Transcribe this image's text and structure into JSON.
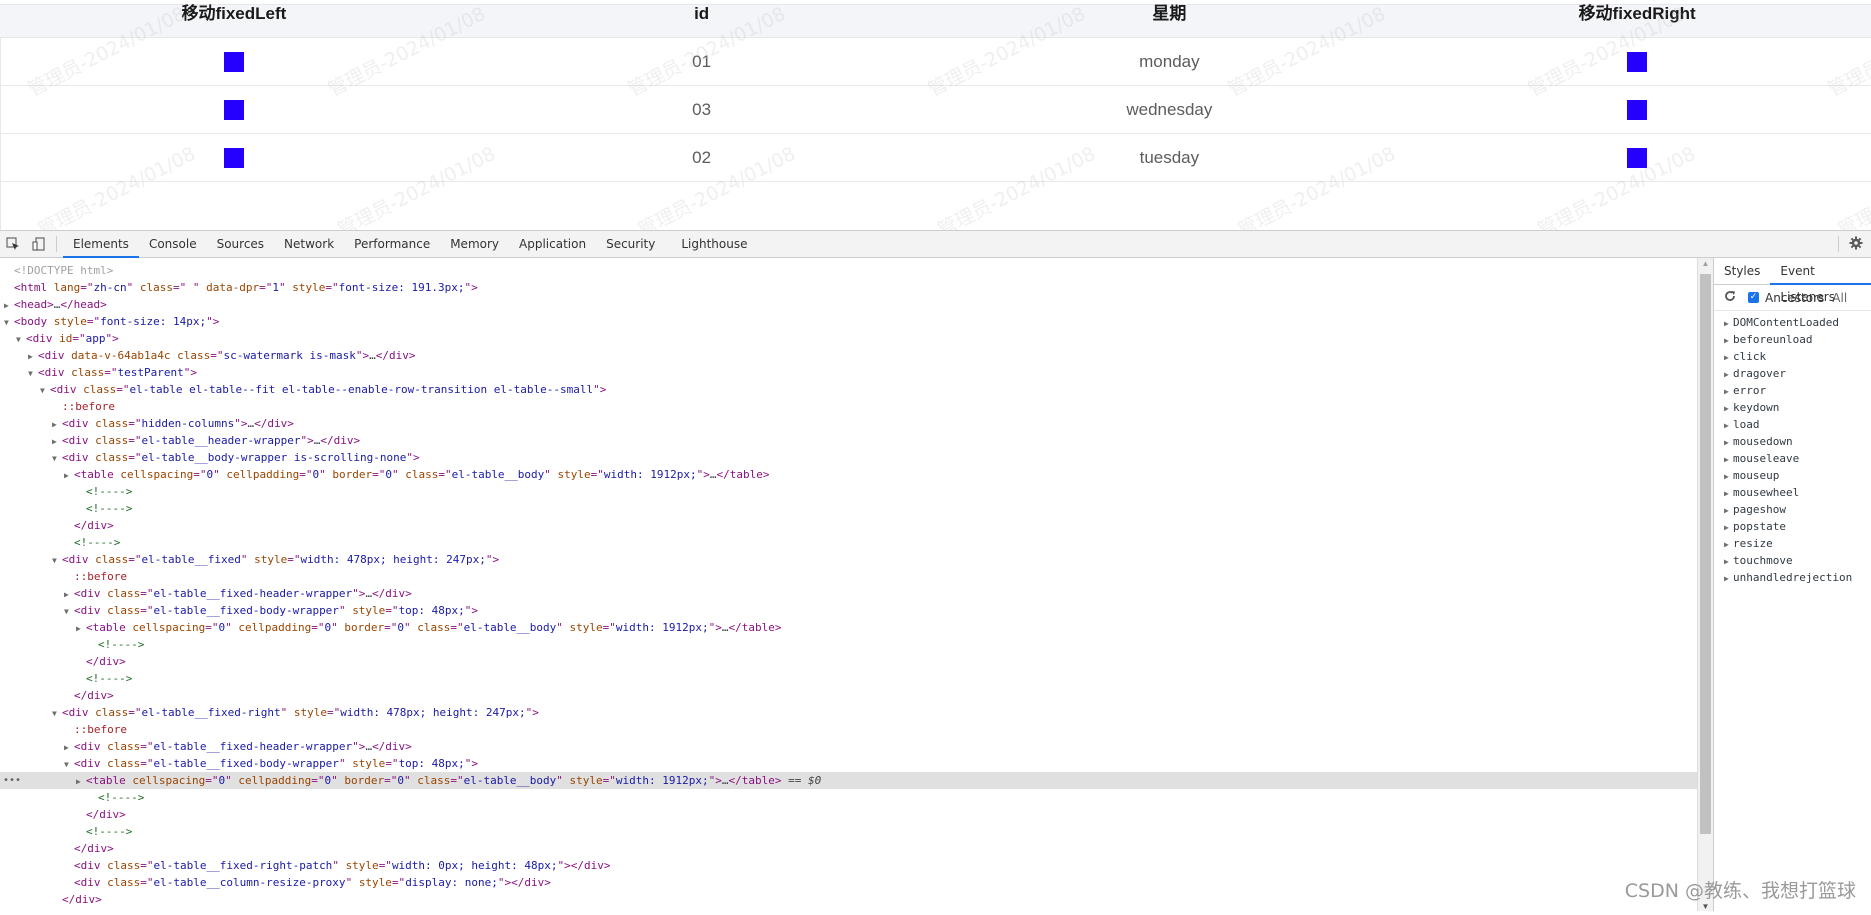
{
  "table": {
    "columns": [
      "移动fixedLeft",
      "id",
      "星期",
      "移动fixedRight"
    ],
    "rows": [
      {
        "id": "01",
        "day": "monday"
      },
      {
        "id": "03",
        "day": "wednesday"
      },
      {
        "id": "02",
        "day": "tuesday"
      }
    ],
    "cell_square_color": "#2600ff",
    "watermark": "管理员-2024/01/08"
  },
  "devtools": {
    "tabs": [
      "Elements",
      "Console",
      "Sources",
      "Network",
      "Performance",
      "Memory",
      "Application",
      "Security",
      "Lighthouse"
    ],
    "active_tab": "Elements",
    "icons": [
      "inspect-element-icon",
      "device-toolbar-icon",
      "settings-gear-icon"
    ],
    "dom_lines": [
      {
        "indent": 0,
        "tri": "",
        "parts": [
          [
            "dt",
            "<!DOCTYPE html>"
          ]
        ]
      },
      {
        "indent": 0,
        "tri": "",
        "parts": [
          [
            "tag",
            "<html "
          ],
          [
            "an",
            "lang"
          ],
          [
            "tag",
            "=\""
          ],
          [
            "av",
            "zh-cn"
          ],
          [
            "tag",
            "\" "
          ],
          [
            "an",
            "class"
          ],
          [
            "tag",
            "=\""
          ],
          [
            "av",
            " "
          ],
          [
            "tag",
            "\" "
          ],
          [
            "an",
            "data-dpr"
          ],
          [
            "tag",
            "=\""
          ],
          [
            "av",
            "1"
          ],
          [
            "tag",
            "\" "
          ],
          [
            "an",
            "style"
          ],
          [
            "tag",
            "=\""
          ],
          [
            "av",
            "font-size: 191.3px;"
          ],
          [
            "tag",
            "\">"
          ]
        ]
      },
      {
        "indent": 0,
        "tri": "▶",
        "parts": [
          [
            "tag",
            "<head>"
          ],
          [
            "",
            "…"
          ],
          [
            "tag",
            "</head>"
          ]
        ]
      },
      {
        "indent": 0,
        "tri": "▼",
        "parts": [
          [
            "tag",
            "<body "
          ],
          [
            "an",
            "style"
          ],
          [
            "tag",
            "=\""
          ],
          [
            "av",
            "font-size: 14px;"
          ],
          [
            "tag",
            "\">"
          ]
        ]
      },
      {
        "indent": 1,
        "tri": "▼",
        "parts": [
          [
            "tag",
            "<div "
          ],
          [
            "an",
            "id"
          ],
          [
            "tag",
            "=\""
          ],
          [
            "av",
            "app"
          ],
          [
            "tag",
            "\">"
          ]
        ]
      },
      {
        "indent": 2,
        "tri": "▶",
        "parts": [
          [
            "tag",
            "<div "
          ],
          [
            "an",
            "data-v-64ab1a4c class"
          ],
          [
            "tag",
            "=\""
          ],
          [
            "av",
            "sc-watermark is-mask"
          ],
          [
            "tag",
            "\">"
          ],
          [
            "",
            "…"
          ],
          [
            "tag",
            "</div>"
          ]
        ]
      },
      {
        "indent": 2,
        "tri": "▼",
        "parts": [
          [
            "tag",
            "<div "
          ],
          [
            "an",
            "class"
          ],
          [
            "tag",
            "=\""
          ],
          [
            "av",
            "testParent"
          ],
          [
            "tag",
            "\">"
          ]
        ]
      },
      {
        "indent": 3,
        "tri": "▼",
        "parts": [
          [
            "tag",
            "<div "
          ],
          [
            "an",
            "class"
          ],
          [
            "tag",
            "=\""
          ],
          [
            "av",
            "el-table el-table--fit el-table--enable-row-transition el-table--small"
          ],
          [
            "tag",
            "\">"
          ]
        ]
      },
      {
        "indent": 4,
        "tri": "",
        "parts": [
          [
            "ps",
            "::before"
          ]
        ]
      },
      {
        "indent": 4,
        "tri": "▶",
        "parts": [
          [
            "tag",
            "<div "
          ],
          [
            "an",
            "class"
          ],
          [
            "tag",
            "=\""
          ],
          [
            "av",
            "hidden-columns"
          ],
          [
            "tag",
            "\">"
          ],
          [
            "",
            "…"
          ],
          [
            "tag",
            "</div>"
          ]
        ]
      },
      {
        "indent": 4,
        "tri": "▶",
        "parts": [
          [
            "tag",
            "<div "
          ],
          [
            "an",
            "class"
          ],
          [
            "tag",
            "=\""
          ],
          [
            "av",
            "el-table__header-wrapper"
          ],
          [
            "tag",
            "\">"
          ],
          [
            "",
            "…"
          ],
          [
            "tag",
            "</div>"
          ]
        ]
      },
      {
        "indent": 4,
        "tri": "▼",
        "parts": [
          [
            "tag",
            "<div "
          ],
          [
            "an",
            "class"
          ],
          [
            "tag",
            "=\""
          ],
          [
            "av",
            "el-table__body-wrapper is-scrolling-none"
          ],
          [
            "tag",
            "\">"
          ]
        ]
      },
      {
        "indent": 5,
        "tri": "▶",
        "parts": [
          [
            "tag",
            "<table "
          ],
          [
            "an",
            "cellspacing"
          ],
          [
            "tag",
            "=\""
          ],
          [
            "av",
            "0"
          ],
          [
            "tag",
            "\" "
          ],
          [
            "an",
            "cellpadding"
          ],
          [
            "tag",
            "=\""
          ],
          [
            "av",
            "0"
          ],
          [
            "tag",
            "\" "
          ],
          [
            "an",
            "border"
          ],
          [
            "tag",
            "=\""
          ],
          [
            "av",
            "0"
          ],
          [
            "tag",
            "\" "
          ],
          [
            "an",
            "class"
          ],
          [
            "tag",
            "=\""
          ],
          [
            "av",
            "el-table__body"
          ],
          [
            "tag",
            "\" "
          ],
          [
            "an",
            "style"
          ],
          [
            "tag",
            "=\""
          ],
          [
            "av",
            "width: 1912px;"
          ],
          [
            "tag",
            "\">"
          ],
          [
            "",
            "…"
          ],
          [
            "tag",
            "</table>"
          ]
        ]
      },
      {
        "indent": 6,
        "tri": "",
        "parts": [
          [
            "cm",
            "<!---->"
          ]
        ]
      },
      {
        "indent": 6,
        "tri": "",
        "parts": [
          [
            "cm",
            "<!---->"
          ]
        ]
      },
      {
        "indent": 5,
        "tri": "",
        "parts": [
          [
            "tag",
            "</div>"
          ]
        ]
      },
      {
        "indent": 5,
        "tri": "",
        "parts": [
          [
            "cm",
            "<!---->"
          ]
        ]
      },
      {
        "indent": 4,
        "tri": "▼",
        "parts": [
          [
            "tag",
            "<div "
          ],
          [
            "an",
            "class"
          ],
          [
            "tag",
            "=\""
          ],
          [
            "av",
            "el-table__fixed"
          ],
          [
            "tag",
            "\" "
          ],
          [
            "an",
            "style"
          ],
          [
            "tag",
            "=\""
          ],
          [
            "av",
            "width: 478px; height: 247px;"
          ],
          [
            "tag",
            "\">"
          ]
        ]
      },
      {
        "indent": 5,
        "tri": "",
        "parts": [
          [
            "ps",
            "::before"
          ]
        ]
      },
      {
        "indent": 5,
        "tri": "▶",
        "parts": [
          [
            "tag",
            "<div "
          ],
          [
            "an",
            "class"
          ],
          [
            "tag",
            "=\""
          ],
          [
            "av",
            "el-table__fixed-header-wrapper"
          ],
          [
            "tag",
            "\">"
          ],
          [
            "",
            "…"
          ],
          [
            "tag",
            "</div>"
          ]
        ]
      },
      {
        "indent": 5,
        "tri": "▼",
        "parts": [
          [
            "tag",
            "<div "
          ],
          [
            "an",
            "class"
          ],
          [
            "tag",
            "=\""
          ],
          [
            "av",
            "el-table__fixed-body-wrapper"
          ],
          [
            "tag",
            "\" "
          ],
          [
            "an",
            "style"
          ],
          [
            "tag",
            "=\""
          ],
          [
            "av",
            "top: 48px;"
          ],
          [
            "tag",
            "\">"
          ]
        ]
      },
      {
        "indent": 6,
        "tri": "▶",
        "parts": [
          [
            "tag",
            "<table "
          ],
          [
            "an",
            "cellspacing"
          ],
          [
            "tag",
            "=\""
          ],
          [
            "av",
            "0"
          ],
          [
            "tag",
            "\" "
          ],
          [
            "an",
            "cellpadding"
          ],
          [
            "tag",
            "=\""
          ],
          [
            "av",
            "0"
          ],
          [
            "tag",
            "\" "
          ],
          [
            "an",
            "border"
          ],
          [
            "tag",
            "=\""
          ],
          [
            "av",
            "0"
          ],
          [
            "tag",
            "\" "
          ],
          [
            "an",
            "class"
          ],
          [
            "tag",
            "=\""
          ],
          [
            "av",
            "el-table__body"
          ],
          [
            "tag",
            "\" "
          ],
          [
            "an",
            "style"
          ],
          [
            "tag",
            "=\""
          ],
          [
            "av",
            "width: 1912px;"
          ],
          [
            "tag",
            "\">"
          ],
          [
            "",
            "…"
          ],
          [
            "tag",
            "</table>"
          ]
        ]
      },
      {
        "indent": 7,
        "tri": "",
        "parts": [
          [
            "cm",
            "<!---->"
          ]
        ]
      },
      {
        "indent": 6,
        "tri": "",
        "parts": [
          [
            "tag",
            "</div>"
          ]
        ]
      },
      {
        "indent": 6,
        "tri": "",
        "parts": [
          [
            "cm",
            "<!---->"
          ]
        ]
      },
      {
        "indent": 5,
        "tri": "",
        "parts": [
          [
            "tag",
            "</div>"
          ]
        ]
      },
      {
        "indent": 4,
        "tri": "▼",
        "parts": [
          [
            "tag",
            "<div "
          ],
          [
            "an",
            "class"
          ],
          [
            "tag",
            "=\""
          ],
          [
            "av",
            "el-table__fixed-right"
          ],
          [
            "tag",
            "\" "
          ],
          [
            "an",
            "style"
          ],
          [
            "tag",
            "=\""
          ],
          [
            "av",
            "width: 478px; height: 247px;"
          ],
          [
            "tag",
            "\">"
          ]
        ]
      },
      {
        "indent": 5,
        "tri": "",
        "parts": [
          [
            "ps",
            "::before"
          ]
        ]
      },
      {
        "indent": 5,
        "tri": "▶",
        "parts": [
          [
            "tag",
            "<div "
          ],
          [
            "an",
            "class"
          ],
          [
            "tag",
            "=\""
          ],
          [
            "av",
            "el-table__fixed-header-wrapper"
          ],
          [
            "tag",
            "\">"
          ],
          [
            "",
            "…"
          ],
          [
            "tag",
            "</div>"
          ]
        ]
      },
      {
        "indent": 5,
        "tri": "▼",
        "parts": [
          [
            "tag",
            "<div "
          ],
          [
            "an",
            "class"
          ],
          [
            "tag",
            "=\""
          ],
          [
            "av",
            "el-table__fixed-body-wrapper"
          ],
          [
            "tag",
            "\" "
          ],
          [
            "an",
            "style"
          ],
          [
            "tag",
            "=\""
          ],
          [
            "av",
            "top: 48px;"
          ],
          [
            "tag",
            "\">"
          ]
        ]
      },
      {
        "indent": 6,
        "tri": "▶",
        "selected": true,
        "parts": [
          [
            "tag",
            "<table "
          ],
          [
            "an",
            "cellspacing"
          ],
          [
            "tag",
            "=\""
          ],
          [
            "av",
            "0"
          ],
          [
            "tag",
            "\" "
          ],
          [
            "an",
            "cellpadding"
          ],
          [
            "tag",
            "=\""
          ],
          [
            "av",
            "0"
          ],
          [
            "tag",
            "\" "
          ],
          [
            "an",
            "border"
          ],
          [
            "tag",
            "=\""
          ],
          [
            "av",
            "0"
          ],
          [
            "tag",
            "\" "
          ],
          [
            "an",
            "class"
          ],
          [
            "tag",
            "=\""
          ],
          [
            "av",
            "el-table__body"
          ],
          [
            "tag",
            "\" "
          ],
          [
            "an",
            "style"
          ],
          [
            "tag",
            "=\""
          ],
          [
            "av",
            "width: 1912px;"
          ],
          [
            "tag",
            "\">"
          ],
          [
            "",
            "…"
          ],
          [
            "tag",
            "</table>"
          ],
          [
            "eq",
            " == $0"
          ]
        ]
      },
      {
        "indent": 7,
        "tri": "",
        "parts": [
          [
            "cm",
            "<!---->"
          ]
        ]
      },
      {
        "indent": 6,
        "tri": "",
        "parts": [
          [
            "tag",
            "</div>"
          ]
        ]
      },
      {
        "indent": 6,
        "tri": "",
        "parts": [
          [
            "cm",
            "<!---->"
          ]
        ]
      },
      {
        "indent": 5,
        "tri": "",
        "parts": [
          [
            "tag",
            "</div>"
          ]
        ]
      },
      {
        "indent": 5,
        "tri": "",
        "parts": [
          [
            "tag",
            "<div "
          ],
          [
            "an",
            "class"
          ],
          [
            "tag",
            "=\""
          ],
          [
            "av",
            "el-table__fixed-right-patch"
          ],
          [
            "tag",
            "\" "
          ],
          [
            "an",
            "style"
          ],
          [
            "tag",
            "=\""
          ],
          [
            "av",
            "width: 0px; height: 48px;"
          ],
          [
            "tag",
            "\"></div>"
          ]
        ]
      },
      {
        "indent": 5,
        "tri": "",
        "parts": [
          [
            "tag",
            "<div "
          ],
          [
            "an",
            "class"
          ],
          [
            "tag",
            "=\""
          ],
          [
            "av",
            "el-table__column-resize-proxy"
          ],
          [
            "tag",
            "\" "
          ],
          [
            "an",
            "style"
          ],
          [
            "tag",
            "=\""
          ],
          [
            "av",
            "display: none;"
          ],
          [
            "tag",
            "\"></div>"
          ]
        ]
      },
      {
        "indent": 4,
        "tri": "",
        "parts": [
          [
            "tag",
            "</div>"
          ]
        ]
      }
    ],
    "selected_dots": "•••",
    "sidebar": {
      "tabs": [
        "Styles",
        "Event Listeners"
      ],
      "active_tab": "Event Listeners",
      "ancestors_label": "Ancestors",
      "ancestors_checked": true,
      "all_label": "All",
      "events": [
        "DOMContentLoaded",
        "beforeunload",
        "click",
        "dragover",
        "error",
        "keydown",
        "load",
        "mousedown",
        "mouseleave",
        "mouseup",
        "mousewheel",
        "pageshow",
        "popstate",
        "resize",
        "touchmove",
        "unhandledrejection"
      ]
    }
  },
  "credit": "CSDN @教练、我想打篮球"
}
